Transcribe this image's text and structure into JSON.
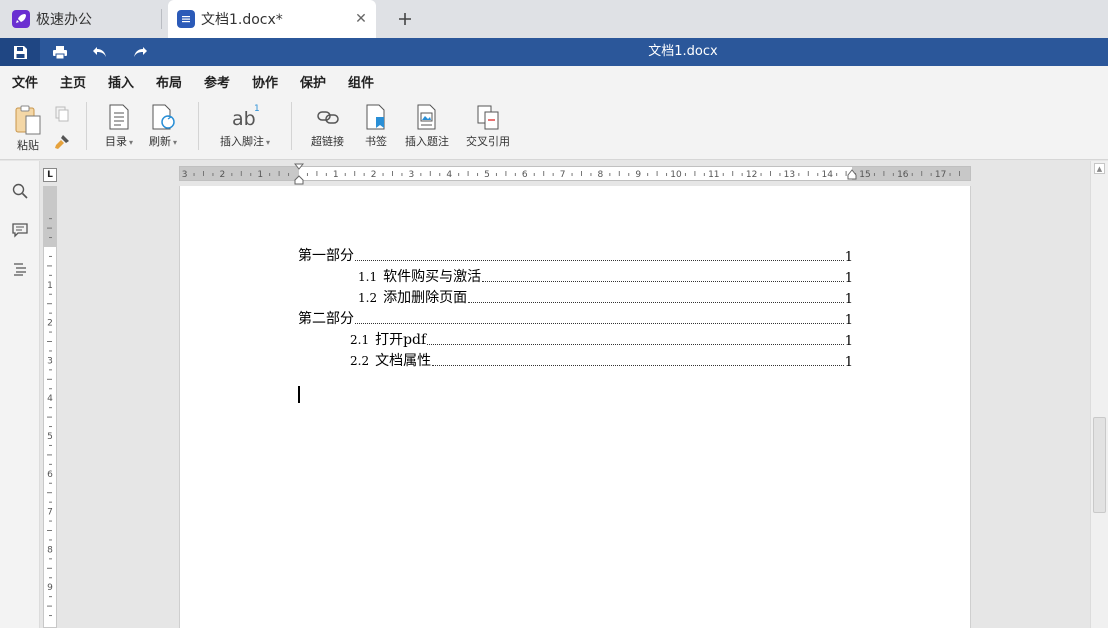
{
  "tabs": {
    "home": "极速办公",
    "doc": "文档1.docx*"
  },
  "titlebar": {
    "doc_title": "文档1.docx"
  },
  "menu": [
    "文件",
    "主页",
    "插入",
    "布局",
    "参考",
    "协作",
    "保护",
    "组件"
  ],
  "active_menu": "参考",
  "ribbon": {
    "paste": "粘贴",
    "toc": "目录",
    "refresh": "刷新",
    "footnote": "插入脚注",
    "footnote_icon_text": "ab",
    "footnote_icon_sup": "1",
    "hyperlink": "超链接",
    "bookmark": "书签",
    "caption": "插入题注",
    "crossref": "交叉引用"
  },
  "hruler_numbers": [
    "3",
    "2",
    "1",
    "1",
    "2",
    "3",
    "4",
    "5",
    "6",
    "7",
    "8",
    "9",
    "10",
    "11",
    "12",
    "13",
    "14",
    "15",
    "16",
    "17"
  ],
  "vruler_numbers": [
    "1",
    "2",
    "3",
    "4",
    "5",
    "6",
    "7",
    "8",
    "9"
  ],
  "toc": [
    {
      "num": "",
      "text": "第一部分",
      "page": "1"
    },
    {
      "num": "1.1",
      "text": "软件购买与激活",
      "page": "1"
    },
    {
      "num": "1.2",
      "text": "添加删除页面",
      "page": "1"
    },
    {
      "num": "",
      "text": "第二部分",
      "page": "1"
    },
    {
      "num": "2.1",
      "text": "打开pdf",
      "page": "1"
    },
    {
      "num": "2.2",
      "text": "文档属性",
      "page": "1"
    }
  ],
  "colors": {
    "accent": "#2b579a",
    "app_icon": "#6a2fd1",
    "doc_icon": "#2b5ab8"
  }
}
